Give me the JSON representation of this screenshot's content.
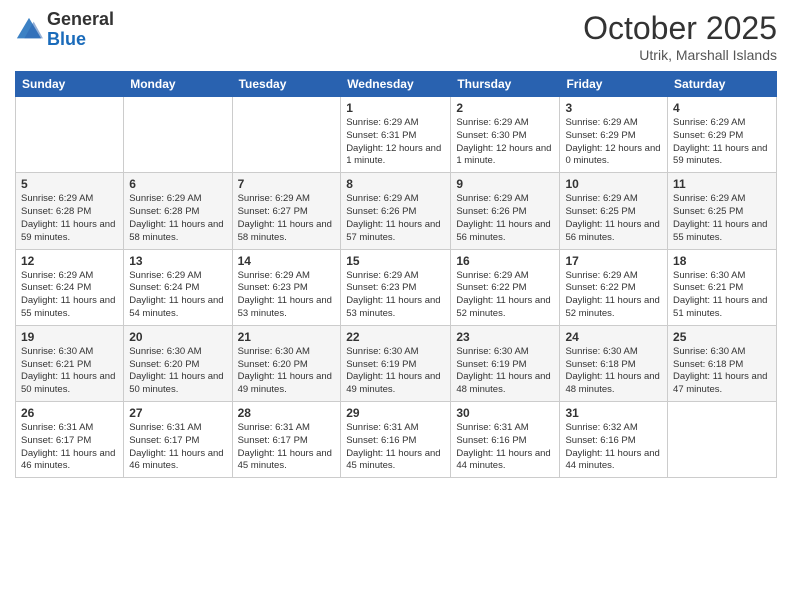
{
  "header": {
    "logo_general": "General",
    "logo_blue": "Blue",
    "month": "October 2025",
    "location": "Utrik, Marshall Islands"
  },
  "weekdays": [
    "Sunday",
    "Monday",
    "Tuesday",
    "Wednesday",
    "Thursday",
    "Friday",
    "Saturday"
  ],
  "weeks": [
    [
      {
        "day": "",
        "text": ""
      },
      {
        "day": "",
        "text": ""
      },
      {
        "day": "",
        "text": ""
      },
      {
        "day": "1",
        "text": "Sunrise: 6:29 AM\nSunset: 6:31 PM\nDaylight: 12 hours\nand 1 minute."
      },
      {
        "day": "2",
        "text": "Sunrise: 6:29 AM\nSunset: 6:30 PM\nDaylight: 12 hours\nand 1 minute."
      },
      {
        "day": "3",
        "text": "Sunrise: 6:29 AM\nSunset: 6:29 PM\nDaylight: 12 hours\nand 0 minutes."
      },
      {
        "day": "4",
        "text": "Sunrise: 6:29 AM\nSunset: 6:29 PM\nDaylight: 11 hours\nand 59 minutes."
      }
    ],
    [
      {
        "day": "5",
        "text": "Sunrise: 6:29 AM\nSunset: 6:28 PM\nDaylight: 11 hours\nand 59 minutes."
      },
      {
        "day": "6",
        "text": "Sunrise: 6:29 AM\nSunset: 6:28 PM\nDaylight: 11 hours\nand 58 minutes."
      },
      {
        "day": "7",
        "text": "Sunrise: 6:29 AM\nSunset: 6:27 PM\nDaylight: 11 hours\nand 58 minutes."
      },
      {
        "day": "8",
        "text": "Sunrise: 6:29 AM\nSunset: 6:26 PM\nDaylight: 11 hours\nand 57 minutes."
      },
      {
        "day": "9",
        "text": "Sunrise: 6:29 AM\nSunset: 6:26 PM\nDaylight: 11 hours\nand 56 minutes."
      },
      {
        "day": "10",
        "text": "Sunrise: 6:29 AM\nSunset: 6:25 PM\nDaylight: 11 hours\nand 56 minutes."
      },
      {
        "day": "11",
        "text": "Sunrise: 6:29 AM\nSunset: 6:25 PM\nDaylight: 11 hours\nand 55 minutes."
      }
    ],
    [
      {
        "day": "12",
        "text": "Sunrise: 6:29 AM\nSunset: 6:24 PM\nDaylight: 11 hours\nand 55 minutes."
      },
      {
        "day": "13",
        "text": "Sunrise: 6:29 AM\nSunset: 6:24 PM\nDaylight: 11 hours\nand 54 minutes."
      },
      {
        "day": "14",
        "text": "Sunrise: 6:29 AM\nSunset: 6:23 PM\nDaylight: 11 hours\nand 53 minutes."
      },
      {
        "day": "15",
        "text": "Sunrise: 6:29 AM\nSunset: 6:23 PM\nDaylight: 11 hours\nand 53 minutes."
      },
      {
        "day": "16",
        "text": "Sunrise: 6:29 AM\nSunset: 6:22 PM\nDaylight: 11 hours\nand 52 minutes."
      },
      {
        "day": "17",
        "text": "Sunrise: 6:29 AM\nSunset: 6:22 PM\nDaylight: 11 hours\nand 52 minutes."
      },
      {
        "day": "18",
        "text": "Sunrise: 6:30 AM\nSunset: 6:21 PM\nDaylight: 11 hours\nand 51 minutes."
      }
    ],
    [
      {
        "day": "19",
        "text": "Sunrise: 6:30 AM\nSunset: 6:21 PM\nDaylight: 11 hours\nand 50 minutes."
      },
      {
        "day": "20",
        "text": "Sunrise: 6:30 AM\nSunset: 6:20 PM\nDaylight: 11 hours\nand 50 minutes."
      },
      {
        "day": "21",
        "text": "Sunrise: 6:30 AM\nSunset: 6:20 PM\nDaylight: 11 hours\nand 49 minutes."
      },
      {
        "day": "22",
        "text": "Sunrise: 6:30 AM\nSunset: 6:19 PM\nDaylight: 11 hours\nand 49 minutes."
      },
      {
        "day": "23",
        "text": "Sunrise: 6:30 AM\nSunset: 6:19 PM\nDaylight: 11 hours\nand 48 minutes."
      },
      {
        "day": "24",
        "text": "Sunrise: 6:30 AM\nSunset: 6:18 PM\nDaylight: 11 hours\nand 48 minutes."
      },
      {
        "day": "25",
        "text": "Sunrise: 6:30 AM\nSunset: 6:18 PM\nDaylight: 11 hours\nand 47 minutes."
      }
    ],
    [
      {
        "day": "26",
        "text": "Sunrise: 6:31 AM\nSunset: 6:17 PM\nDaylight: 11 hours\nand 46 minutes."
      },
      {
        "day": "27",
        "text": "Sunrise: 6:31 AM\nSunset: 6:17 PM\nDaylight: 11 hours\nand 46 minutes."
      },
      {
        "day": "28",
        "text": "Sunrise: 6:31 AM\nSunset: 6:17 PM\nDaylight: 11 hours\nand 45 minutes."
      },
      {
        "day": "29",
        "text": "Sunrise: 6:31 AM\nSunset: 6:16 PM\nDaylight: 11 hours\nand 45 minutes."
      },
      {
        "day": "30",
        "text": "Sunrise: 6:31 AM\nSunset: 6:16 PM\nDaylight: 11 hours\nand 44 minutes."
      },
      {
        "day": "31",
        "text": "Sunrise: 6:32 AM\nSunset: 6:16 PM\nDaylight: 11 hours\nand 44 minutes."
      },
      {
        "day": "",
        "text": ""
      }
    ]
  ]
}
